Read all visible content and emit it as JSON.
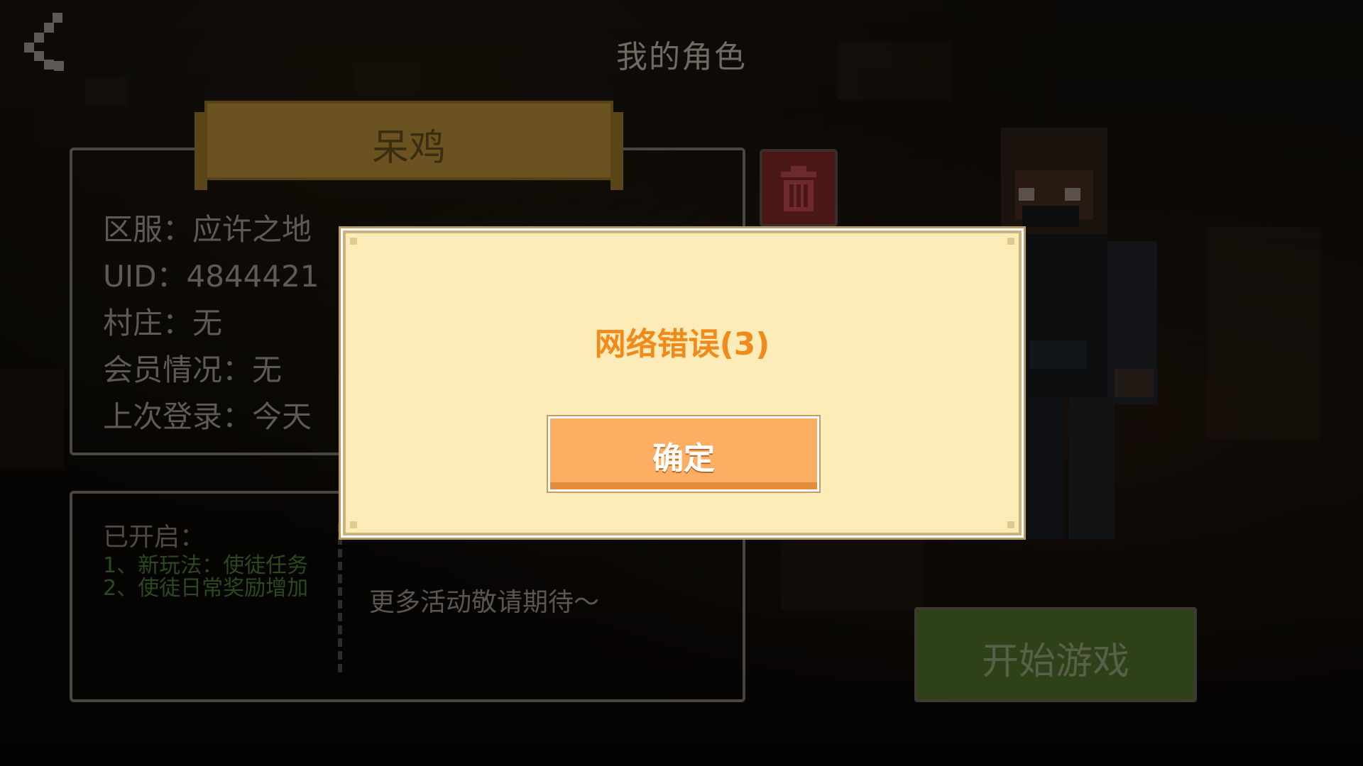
{
  "header": {
    "title": "我的角色",
    "back_icon": "chevron-left-icon"
  },
  "character": {
    "name": "呆鸡",
    "server": "区服：应许之地",
    "uid": "UID：4844421",
    "village": "村庄：无",
    "membership": "会员情况：无",
    "last_login": "上次登录：今天"
  },
  "delete_button": {
    "icon": "trash-icon"
  },
  "activities": {
    "title": "已开启：",
    "items": [
      "1、新玩法：使徒任务",
      "2、使徒日常奖励增加"
    ],
    "more": "更多活动敬请期待～"
  },
  "start_button": {
    "label": "开始游戏"
  },
  "modal": {
    "message": "网络错误(3)",
    "confirm_label": "确定"
  },
  "colors": {
    "modal_bg": "#fdebb8",
    "modal_text": "#f08a1a",
    "confirm_btn": "#fdae62",
    "start_btn": "#2f4118",
    "delete_btn": "#4a1616"
  }
}
